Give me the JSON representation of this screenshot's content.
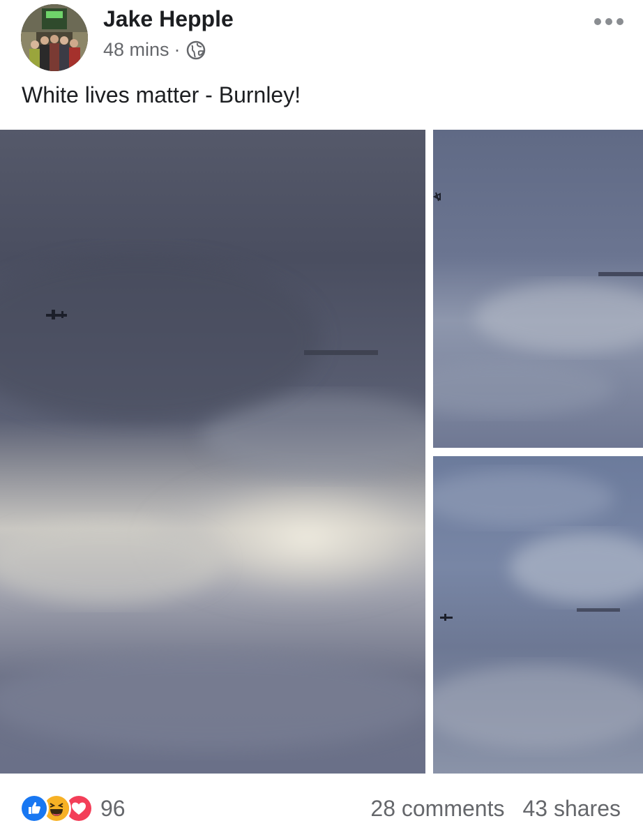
{
  "post": {
    "author": "Jake Hepple",
    "time": "48 mins",
    "separator": "·",
    "privacy_icon": "globe-icon",
    "text": "White lives matter - Burnley!"
  },
  "photos": [
    {
      "label": "sky-with-plane-and-banner"
    },
    {
      "label": "sky-with-plane-and-banner"
    },
    {
      "label": "sky-with-plane-and-banner"
    }
  ],
  "footer": {
    "reaction_icons": [
      "like-icon",
      "haha-icon",
      "love-icon"
    ],
    "reaction_count": "96",
    "comments": "28 comments",
    "shares": "43 shares"
  },
  "colors": {
    "like": "#1877f2",
    "haha": "#f7b125",
    "love": "#f33e58",
    "secondary_text": "#65676b"
  }
}
